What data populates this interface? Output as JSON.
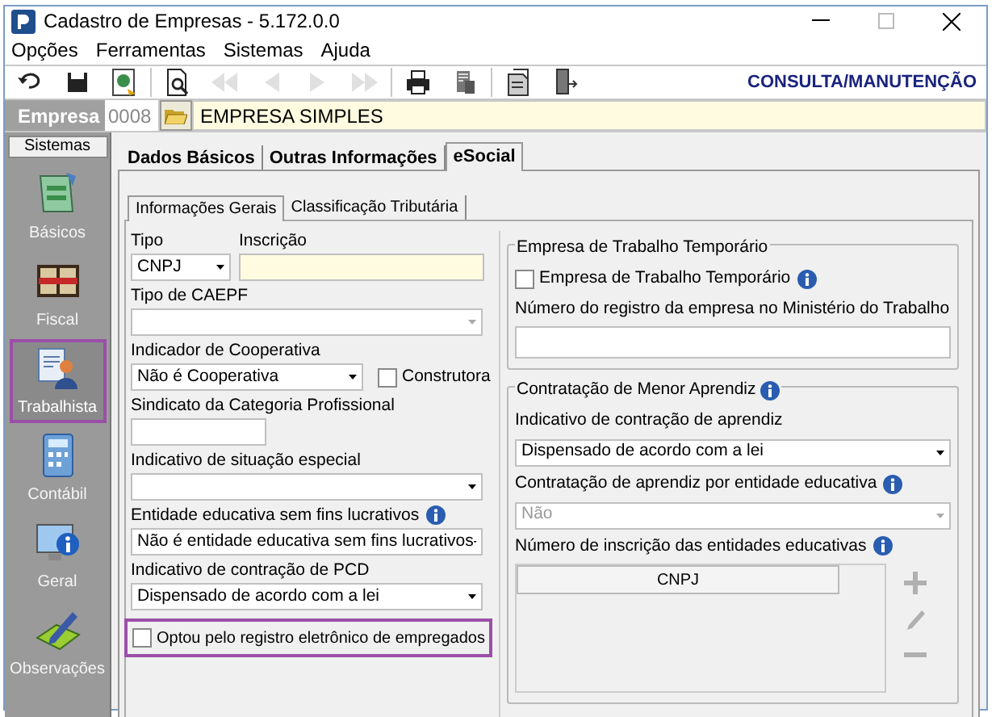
{
  "window": {
    "title": "Cadastro de Empresas - 5.172.0.0"
  },
  "menu": [
    "Opções",
    "Ferramentas",
    "Sistemas",
    "Ajuda"
  ],
  "toolbar": [
    [
      {
        "kind": "undo",
        "disabled": false
      },
      {
        "kind": "save",
        "disabled": false
      },
      {
        "kind": "export",
        "disabled": false
      }
    ],
    [
      {
        "kind": "preview",
        "disabled": false
      },
      {
        "kind": "first",
        "disabled": true
      },
      {
        "kind": "prev",
        "disabled": true
      },
      {
        "kind": "next",
        "disabled": true
      },
      {
        "kind": "last",
        "disabled": true
      }
    ],
    [
      {
        "kind": "print",
        "disabled": false
      },
      {
        "kind": "tools",
        "disabled": false
      }
    ],
    [
      {
        "kind": "report",
        "disabled": false
      },
      {
        "kind": "exit",
        "disabled": false
      }
    ]
  ],
  "mode_label": "CONSULTA/MANUTENÇÃO",
  "empresa": {
    "label": "Empresa",
    "code": "0008",
    "name": "EMPRESA SIMPLES"
  },
  "sidebar": {
    "header": "Sistemas",
    "items": [
      {
        "label": "Básicos",
        "kind": "document",
        "selected": false,
        "highlighted": false
      },
      {
        "label": "Fiscal",
        "kind": "book",
        "selected": false,
        "highlighted": false
      },
      {
        "label": "Trabalhista",
        "kind": "person",
        "selected": true,
        "highlighted": true
      },
      {
        "label": "Contábil",
        "kind": "calculator",
        "selected": false,
        "highlighted": false
      },
      {
        "label": "Geral",
        "kind": "monitor",
        "selected": false,
        "highlighted": false
      },
      {
        "label": "Observações",
        "kind": "pencil",
        "selected": false,
        "highlighted": false
      }
    ]
  },
  "tabs": [
    {
      "label": "Dados Básicos",
      "selected": false
    },
    {
      "label": "Outras Informações",
      "selected": false
    },
    {
      "label": "eSocial",
      "selected": true
    }
  ],
  "subtabs": [
    {
      "label": "Informações Gerais",
      "selected": true
    },
    {
      "label": "Classificação Tributária",
      "selected": false
    }
  ],
  "left_form": [
    [
      {
        "kind": "select",
        "label": "Tipo",
        "value": "CNPJ",
        "disabled": false
      },
      {
        "kind": "text",
        "label": "Inscrição",
        "required": true
      }
    ],
    [
      {
        "kind": "select",
        "label": "Tipo de CAEPF",
        "disabled": true
      }
    ],
    [
      {
        "kind": "select",
        "label": "Indicador de Cooperativa",
        "value": "Não é Cooperativa",
        "disabled": false
      },
      {
        "kind": "checkbox",
        "label": "Construtora",
        "checked": false,
        "highlighted": false
      }
    ],
    [
      {
        "kind": "text",
        "label": "Sindicato da Categoria Profissional",
        "required": false
      }
    ],
    [
      {
        "kind": "select",
        "label": "Indicativo de situação especial",
        "disabled": false
      }
    ],
    [
      {
        "kind": "select",
        "label": "Entidade educativa sem fins lucrativos",
        "info": true,
        "value": "Não é entidade educativa sem fins lucrativos",
        "disabled": false
      }
    ],
    [
      {
        "kind": "select",
        "label": "Indicativo de contração de PCD",
        "value": "Dispensado de acordo com a lei",
        "disabled": false
      }
    ],
    [
      {
        "kind": "checkbox",
        "label": "Optou pelo registro eletrônico de empregados",
        "checked": false,
        "highlighted": true
      }
    ]
  ],
  "temp_group": {
    "title": "Empresa de Trabalho Temporário",
    "checkbox": {
      "label": "Empresa de Trabalho Temporário",
      "checked": false,
      "info": true
    },
    "registro_label": "Número do registro da empresa no Ministério do Trabalho"
  },
  "aprendiz_group": {
    "title": "Contratação de Menor Aprendiz",
    "info": true,
    "fields": [
      {
        "kind": "select",
        "label": "Indicativo de contração de aprendiz",
        "value": "Dispensado de acordo com a lei",
        "disabled": false
      },
      {
        "kind": "select",
        "label": "Contratação de aprendiz por entidade educativa",
        "value": "Não",
        "disabled": true,
        "info": true
      }
    ],
    "table_label": "Número de inscrição das entidades educativas",
    "table_info": true,
    "table": {
      "columns": [
        "CNPJ"
      ]
    },
    "actions": [
      {
        "kind": "add",
        "disabled": true
      },
      {
        "kind": "edit",
        "disabled": true
      },
      {
        "kind": "remove",
        "disabled": true
      }
    ]
  }
}
